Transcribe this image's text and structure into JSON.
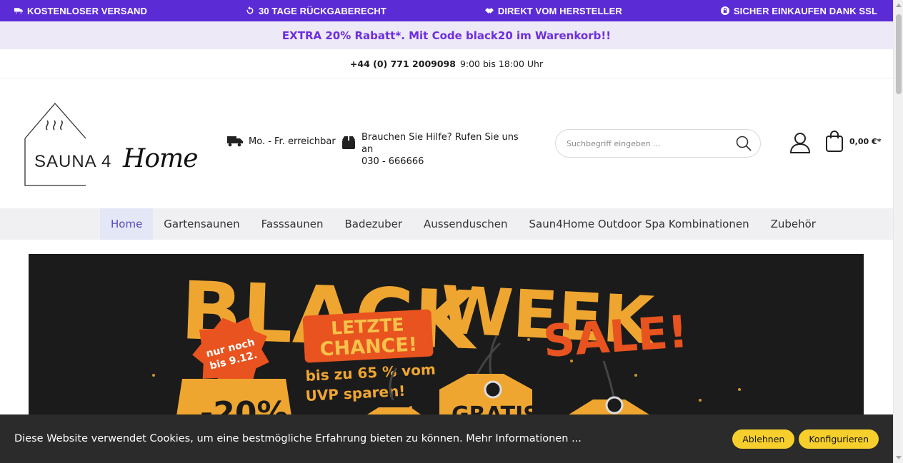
{
  "topbar": {
    "usps": [
      {
        "icon": "truck-icon",
        "label": "KOSTENLOSER VERSAND"
      },
      {
        "icon": "return-icon",
        "label": "30 TAGE RÜCKGABERECHT"
      },
      {
        "icon": "handshake-icon",
        "label": "DIREKT VOM HERSTELLER"
      },
      {
        "icon": "lock-icon",
        "label": "SICHER EINKAUFEN DANK SSL"
      }
    ]
  },
  "promo": {
    "text": "EXTRA 20% Rabatt*. Mit Code black20 im Warenkorb!!"
  },
  "contact": {
    "phone": "+44 (0) 771 2009098",
    "hours": "9:00 bis 18:00 Uhr"
  },
  "logo": {
    "sauna": "SAUNA 4",
    "home": "Home"
  },
  "header": {
    "availability": "Mo. - Fr. erreichbar",
    "help_line1": "Brauchen Sie Hilfe? Rufen Sie uns an",
    "help_line2": "030 - 666666"
  },
  "search": {
    "placeholder": "Suchbegriff eingeben ..."
  },
  "cart": {
    "total": "0,00 €*"
  },
  "nav": {
    "items": [
      "Home",
      "Gartensaunen",
      "Fasssaunen",
      "Badezuber",
      "Aussenduschen",
      "Saun4Home Outdoor Spa Kombinationen",
      "Zubehör"
    ]
  },
  "banner": {
    "headline1": "BLACK",
    "headline2": "WEEK",
    "sale": "SALE!",
    "badge_line1": "nur noch",
    "badge_line2": "bis 9.12.",
    "chance_line1": "LETZTE",
    "chance_line2": "CHANCE!",
    "sub_line1": "bis zu 65 % vom",
    "sub_line2": "UVP sparen!",
    "tag_percent": "-20%",
    "tag_gratis": "GRATIS"
  },
  "cookie": {
    "message": "Diese Website verwendet Cookies, um eine bestmögliche Erfahrung bieten zu können. Mehr Informationen ...",
    "decline": "Ablehnen",
    "configure": "Konfigurieren"
  },
  "colors": {
    "brand_purple": "#5b2bd6",
    "promo_text": "#6d2ee0",
    "banner_orange": "#f2a52b",
    "banner_red": "#e8531f",
    "cookie_button": "#f6cf2c"
  }
}
